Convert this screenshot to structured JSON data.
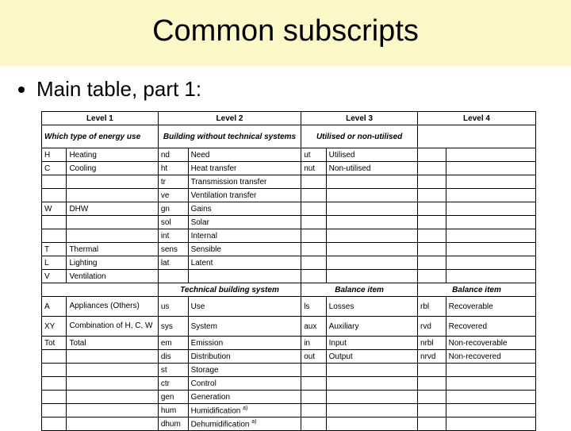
{
  "title": "Common subscripts",
  "bullet": "Main table, part 1:",
  "headers": [
    "Level 1",
    "Level 2",
    "Level 3",
    "Level 4"
  ],
  "section1": {
    "l1": "Which type of energy use",
    "l2": "Building without technical systems",
    "l3": "Utilised or non-utilised",
    "l4": ""
  },
  "section2": {
    "l1": "",
    "l2": "Technical building system",
    "l3": "Balance item",
    "l4": "Balance item"
  },
  "rows1": [
    {
      "c1": "H",
      "t1": "Heating",
      "c2": "nd",
      "t2": "Need",
      "c3": "ut",
      "t3": "Utilised",
      "c4": "",
      "t4": ""
    },
    {
      "c1": "C",
      "t1": "Cooling",
      "c2": "ht",
      "t2": "Heat transfer",
      "c3": "nut",
      "t3": "Non-utilised",
      "c4": "",
      "t4": ""
    },
    {
      "c1": "",
      "t1": "",
      "c2": "tr",
      "t2": "Transmission transfer",
      "c3": "",
      "t3": "",
      "c4": "",
      "t4": ""
    },
    {
      "c1": "",
      "t1": "",
      "c2": "ve",
      "t2": "Ventilation transfer",
      "c3": "",
      "t3": "",
      "c4": "",
      "t4": ""
    },
    {
      "c1": "W",
      "t1": "DHW",
      "c2": "gn",
      "t2": "Gains",
      "c3": "",
      "t3": "",
      "c4": "",
      "t4": ""
    },
    {
      "c1": "",
      "t1": "",
      "c2": "sol",
      "t2": "Solar",
      "c3": "",
      "t3": "",
      "c4": "",
      "t4": ""
    },
    {
      "c1": "",
      "t1": "",
      "c2": "int",
      "t2": "Internal",
      "c3": "",
      "t3": "",
      "c4": "",
      "t4": ""
    },
    {
      "c1": "T",
      "t1": "Thermal",
      "c2": "sens",
      "t2": "Sensible",
      "c3": "",
      "t3": "",
      "c4": "",
      "t4": ""
    },
    {
      "c1": "L",
      "t1": "Lighting",
      "c2": "lat",
      "t2": "Latent",
      "c3": "",
      "t3": "",
      "c4": "",
      "t4": ""
    },
    {
      "c1": "V",
      "t1": "Ventilation",
      "c2": "",
      "t2": "",
      "c3": "",
      "t3": "",
      "c4": "",
      "t4": ""
    }
  ],
  "rows2": [
    {
      "c1": "A",
      "t1": "Appliances (Others)",
      "c2": "us",
      "t2": "Use",
      "c3": "ls",
      "t3": "Losses",
      "c4": "rbl",
      "t4": "Recoverable"
    },
    {
      "c1": "XY",
      "t1": "Combination of H, C, W",
      "c2": "sys",
      "t2": "System",
      "c3": "aux",
      "t3": "Auxiliary",
      "c4": "rvd",
      "t4": "Recovered"
    },
    {
      "c1": "Tot",
      "t1": "Total",
      "c2": "em",
      "t2": "Emission",
      "c3": "in",
      "t3": "Input",
      "c4": "nrbl",
      "t4": "Non-recoverable"
    },
    {
      "c1": "",
      "t1": "",
      "c2": "dis",
      "t2": "Distribution",
      "c3": "out",
      "t3": "Output",
      "c4": "nrvd",
      "t4": "Non-recovered"
    },
    {
      "c1": "",
      "t1": "",
      "c2": "st",
      "t2": "Storage",
      "c3": "",
      "t3": "",
      "c4": "",
      "t4": ""
    },
    {
      "c1": "",
      "t1": "",
      "c2": "ctr",
      "t2": "Control",
      "c3": "",
      "t3": "",
      "c4": "",
      "t4": ""
    },
    {
      "c1": "",
      "t1": "",
      "c2": "gen",
      "t2": "Generation",
      "c3": "",
      "t3": "",
      "c4": "",
      "t4": ""
    },
    {
      "c1": "",
      "t1": "",
      "c2": "hum",
      "t2": "Humidification ",
      "sup2": "a)",
      "c3": "",
      "t3": "",
      "c4": "",
      "t4": ""
    },
    {
      "c1": "",
      "t1": "",
      "c2": "dhum",
      "t2": "Dehumidification ",
      "sup2": "a)",
      "c3": "",
      "t3": "",
      "c4": "",
      "t4": ""
    }
  ]
}
